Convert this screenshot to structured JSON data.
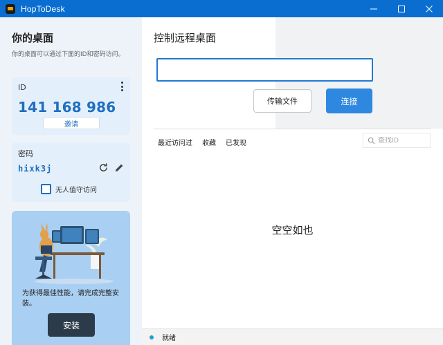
{
  "window": {
    "title": "HopToDesk"
  },
  "left": {
    "title": "你的桌面",
    "subtitle": "你的桌面可以通过下面的ID和密码访问。",
    "id_card": {
      "label": "ID",
      "value": "141 168 986",
      "invite_label": "邀请"
    },
    "password_card": {
      "label": "密码",
      "value": "hixk3j",
      "unattended_label": "无人值守访问",
      "unattended_checked": false
    },
    "install_card": {
      "text": "为获得最佳性能，请完成完整安装。",
      "install_label": "安装"
    }
  },
  "right": {
    "title": "控制远程桌面",
    "id_input": {
      "value": "",
      "placeholder": ""
    },
    "transfer_label": "传输文件",
    "connect_label": "连接",
    "tabs": [
      "最近访问过",
      "收藏",
      "已发现"
    ],
    "search": {
      "placeholder": "查找ID"
    },
    "empty_text": "空空如也"
  },
  "status": {
    "text": "就绪"
  },
  "colors": {
    "titlebar": "#0a6ed1",
    "accent": "#1f6fc0",
    "connect": "#2f88e0",
    "install_card": "#a9cff2"
  }
}
